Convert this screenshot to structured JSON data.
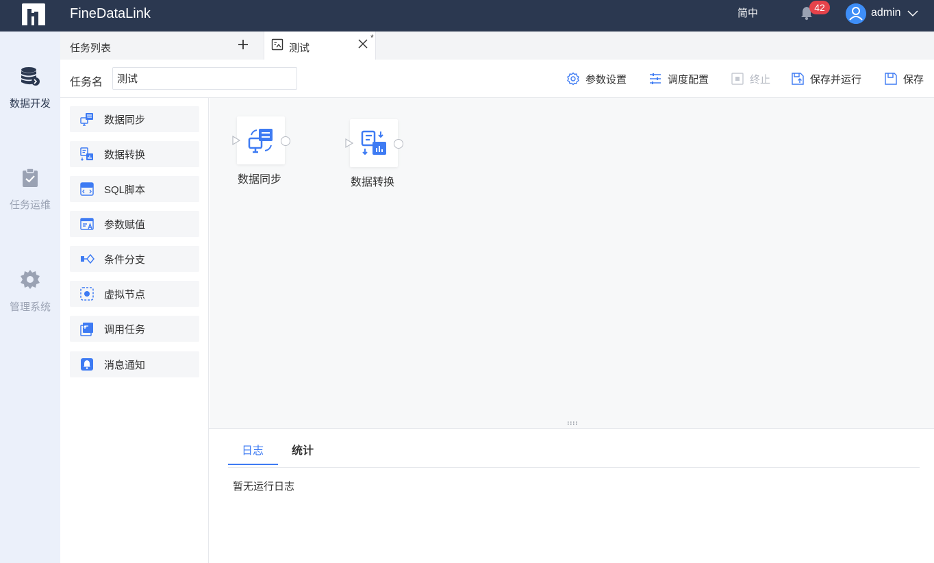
{
  "app": {
    "title": "FineDataLink",
    "language": "简中",
    "notification_count": "42",
    "username": "admin"
  },
  "sidebar": {
    "items": [
      {
        "label": "数据开发",
        "icon": "database-icon",
        "active": true
      },
      {
        "label": "任务运维",
        "icon": "clipboard-check-icon",
        "active": false
      },
      {
        "label": "管理系统",
        "icon": "gear-icon",
        "active": false
      }
    ]
  },
  "tabs": {
    "list_label": "任务列表",
    "active_tab": "测试",
    "modified_mark": "*"
  },
  "toolbar": {
    "taskname_label": "任务名",
    "taskname_value": "测试",
    "buttons": [
      {
        "label": "参数设置",
        "icon": "settings-icon",
        "enabled": true
      },
      {
        "label": "调度配置",
        "icon": "sliders-icon",
        "enabled": true
      },
      {
        "label": "终止",
        "icon": "stop-icon",
        "enabled": false
      },
      {
        "label": "保存并运行",
        "icon": "save-run-icon",
        "enabled": true
      },
      {
        "label": "保存",
        "icon": "save-icon",
        "enabled": true
      }
    ]
  },
  "palette": {
    "items": [
      {
        "label": "数据同步",
        "icon": "data-sync-icon"
      },
      {
        "label": "数据转换",
        "icon": "data-transform-icon"
      },
      {
        "label": "SQL脚本",
        "icon": "sql-script-icon"
      },
      {
        "label": "参数赋值",
        "icon": "parameter-assign-icon"
      },
      {
        "label": "条件分支",
        "icon": "condition-branch-icon"
      },
      {
        "label": "虚拟节点",
        "icon": "virtual-node-icon"
      },
      {
        "label": "调用任务",
        "icon": "invoke-task-icon"
      },
      {
        "label": "消息通知",
        "icon": "notification-icon"
      }
    ]
  },
  "canvas": {
    "nodes": [
      {
        "label": "数据同步",
        "icon": "data-sync-icon"
      },
      {
        "label": "数据转换",
        "icon": "data-transform-icon"
      }
    ]
  },
  "bottom": {
    "tabs": [
      "日志",
      "统计"
    ],
    "empty_text": "暂无运行日志"
  },
  "colors": {
    "topbar": "#2b3850",
    "accent": "#3e7bf3",
    "badge": "#e6434b",
    "sidebar": "#ebf0fa"
  }
}
